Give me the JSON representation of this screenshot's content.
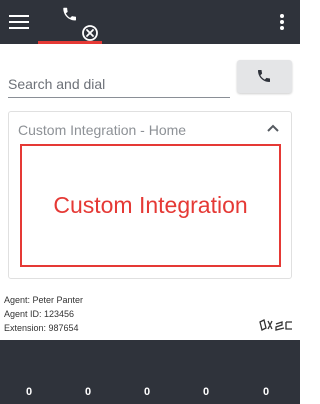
{
  "header": {
    "menu_icon": "hamburger-menu-icon",
    "active_tab_icon": "phone-cancel-icon",
    "more_icon": "more-vertical-icon",
    "accent_color": "#e53935",
    "bar_color": "#2f333b"
  },
  "search": {
    "placeholder": "Search and dial",
    "value": "",
    "dial_icon": "phone-icon"
  },
  "card": {
    "title": "Custom Integration - Home",
    "collapse_icon": "chevron-up-icon",
    "content_label": "Custom Integration"
  },
  "agent": {
    "name_line": "Agent: Peter Panter",
    "id_line": "Agent ID: 123456",
    "extension_line": "Extension: 987654",
    "logo_icon": "brand-logo-icon"
  },
  "stats": [
    "0",
    "0",
    "0",
    "0",
    "0"
  ]
}
